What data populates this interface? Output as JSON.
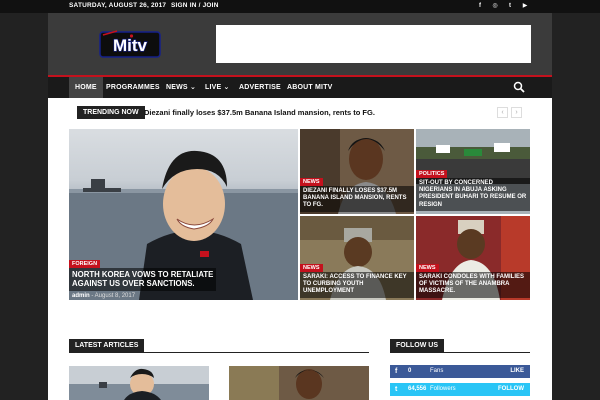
{
  "topbar": {
    "date": "SATURDAY, AUGUST 26, 2017",
    "signin": "SIGN IN / JOIN",
    "social_icons": [
      "facebook-icon",
      "instagram-icon",
      "twitter-icon",
      "youtube-icon"
    ],
    "social_glyphs": [
      "f",
      "◎",
      "t",
      "▶"
    ]
  },
  "brand": {
    "logo_text": "Mitv",
    "accent": "#c4111d",
    "logo_blue": "#15208a"
  },
  "nav": {
    "items": [
      {
        "label": "HOME",
        "active": true
      },
      {
        "label": "PROGRAMMES"
      },
      {
        "label": "NEWS ⌄"
      },
      {
        "label": "LIVE ⌄"
      },
      {
        "label": "ADVERTISE"
      },
      {
        "label": "ABOUT MITV"
      }
    ]
  },
  "trending": {
    "label": "TRENDING NOW",
    "headline": "Diezani finally loses $37.5m Banana Island mansion, rents to FG.",
    "prev": "‹",
    "next": "›"
  },
  "featured": [
    {
      "category": "FOREIGN",
      "headline_line1": "NORTH KOREA VOWS TO RETALIATE",
      "headline_line2": "AGAINST US OVER SANCTIONS.",
      "author": "admin",
      "date": "- August 8, 2017"
    },
    {
      "category": "NEWS",
      "headline": "DIEZANI FINALLY LOSES $37.5M BANANA ISLAND MANSION, RENTS TO FG."
    },
    {
      "category": "POLITICS",
      "headline": "SIT-OUT BY CONCERNED NIGERIANS IN ABUJA ASKING PRESIDENT BUHARI TO RESUME OR RESIGN"
    },
    {
      "category": "NEWS",
      "headline": "SARAKI: ACCESS TO FINANCE KEY TO CURBING YOUTH UNEMPLOYMENT"
    },
    {
      "category": "NEWS",
      "headline": "SARAKI CONDOLES WITH FAMILIES OF VICTIMS OF THE ANAMBRA MASSACRE."
    }
  ],
  "latest": {
    "title": "LATEST ARTICLES"
  },
  "follow": {
    "title": "FOLLOW US",
    "rows": [
      {
        "icon": "facebook-icon",
        "glyph": "f",
        "count": "0",
        "label": "Fans",
        "action": "LIKE",
        "color": "#3b5998"
      },
      {
        "icon": "twitter-icon",
        "glyph": "t",
        "count": "64,556",
        "label": "Followers",
        "action": "FOLLOW",
        "color": "#29c5f6"
      }
    ]
  }
}
